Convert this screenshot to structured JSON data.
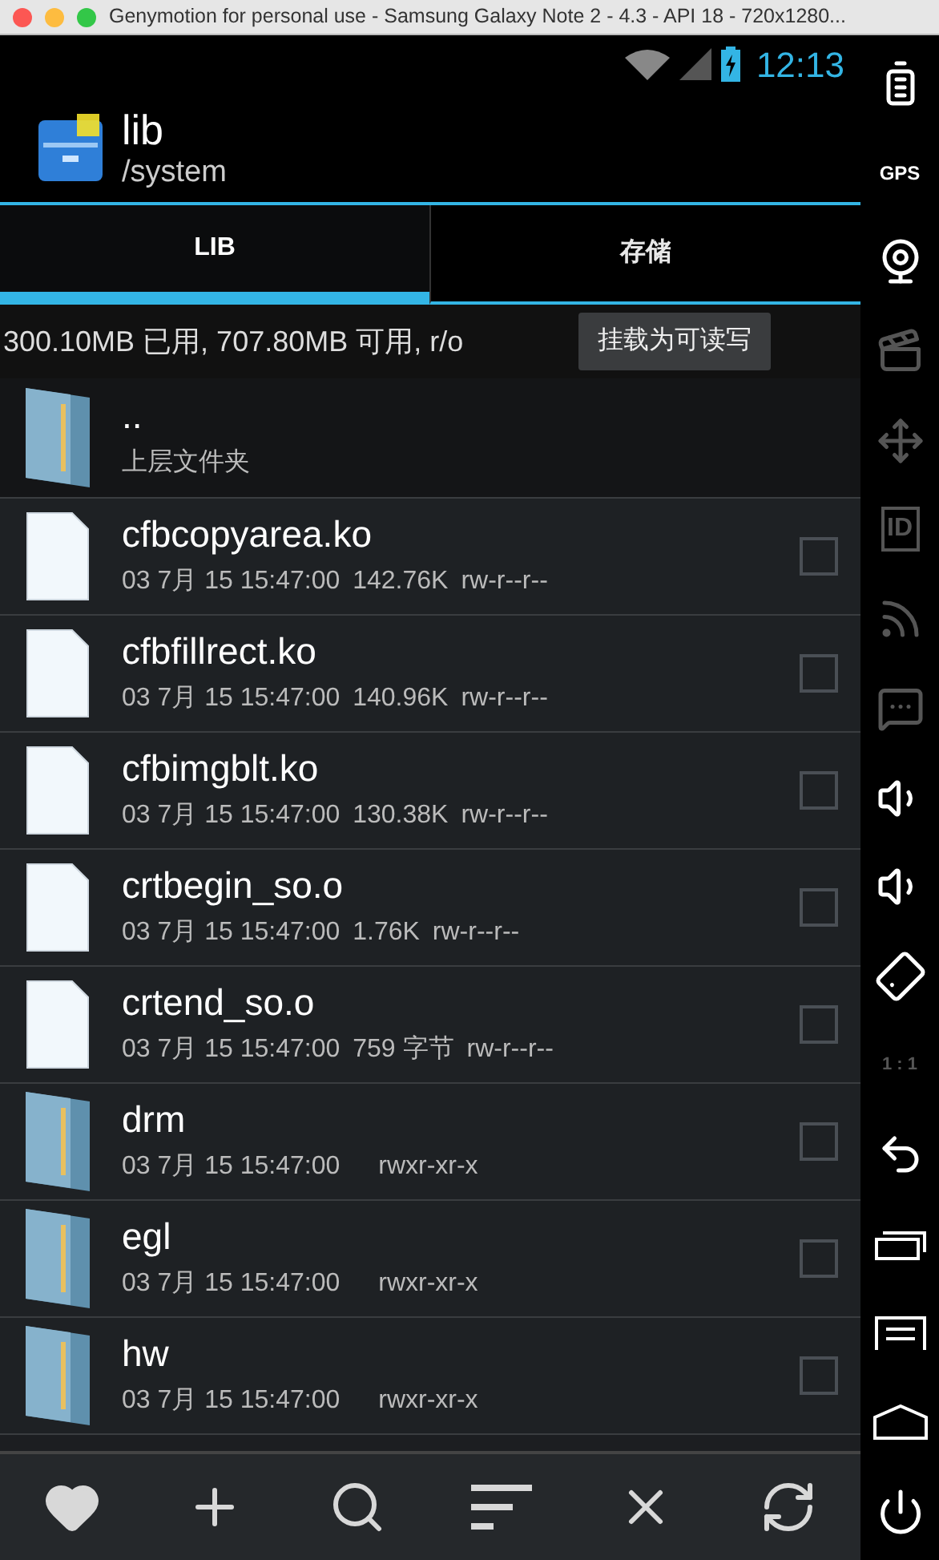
{
  "window": {
    "title": "Genymotion for personal use - Samsung Galaxy Note 2 - 4.3 - API 18 - 720x1280..."
  },
  "status_bar": {
    "time": "12:13"
  },
  "action_bar": {
    "title": "lib",
    "subtitle": "/system"
  },
  "tabs": [
    {
      "label": "LIB",
      "selected": true
    },
    {
      "label": "存储",
      "selected": false
    }
  ],
  "storage_info": {
    "text": "300.10MB 已用, 707.80MB 可用, r/o",
    "button": "挂载为可读写"
  },
  "files": [
    {
      "kind": "parent",
      "name": "..",
      "detail": "上层文件夹"
    },
    {
      "kind": "file",
      "name": "cfbcopyarea.ko",
      "date": "03 7月 15 15:47:00",
      "size": "142.76K",
      "permissions": "rw-r--r--",
      "checked": false
    },
    {
      "kind": "file",
      "name": "cfbfillrect.ko",
      "date": "03 7月 15 15:47:00",
      "size": "140.96K",
      "permissions": "rw-r--r--",
      "checked": false
    },
    {
      "kind": "file",
      "name": "cfbimgblt.ko",
      "date": "03 7月 15 15:47:00",
      "size": "130.38K",
      "permissions": "rw-r--r--",
      "checked": false
    },
    {
      "kind": "file",
      "name": "crtbegin_so.o",
      "date": "03 7月 15 15:47:00",
      "size": "1.76K",
      "permissions": "rw-r--r--",
      "checked": false
    },
    {
      "kind": "file",
      "name": "crtend_so.o",
      "date": "03 7月 15 15:47:00",
      "size": "759 字节",
      "permissions": "rw-r--r--",
      "checked": false
    },
    {
      "kind": "folder",
      "name": "drm",
      "date": "03 7月 15 15:47:00",
      "permissions": "rwxr-xr-x",
      "checked": false
    },
    {
      "kind": "folder",
      "name": "egl",
      "date": "03 7月 15 15:47:00",
      "permissions": "rwxr-xr-x",
      "checked": false
    },
    {
      "kind": "folder",
      "name": "hw",
      "date": "03 7月 15 15:47:00",
      "permissions": "rwxr-xr-x",
      "checked": false
    }
  ],
  "toolbar": [
    {
      "kind": "favorite"
    },
    {
      "kind": "add"
    },
    {
      "kind": "search"
    },
    {
      "kind": "sort"
    },
    {
      "kind": "close"
    },
    {
      "kind": "refresh"
    }
  ],
  "emulator_sidebar": [
    {
      "kind": "battery"
    },
    {
      "kind": "gps",
      "label": "GPS"
    },
    {
      "kind": "webcam"
    },
    {
      "kind": "clapper",
      "disabled": true
    },
    {
      "kind": "dpad",
      "disabled": true
    },
    {
      "kind": "id",
      "label": "ID",
      "disabled": true
    },
    {
      "kind": "cast",
      "disabled": true
    },
    {
      "kind": "sms",
      "disabled": true
    },
    {
      "kind": "volume_up"
    },
    {
      "kind": "volume_down"
    },
    {
      "kind": "rotate"
    },
    {
      "kind": "scale",
      "label": "1 : 1",
      "disabled": true
    },
    {
      "kind": "back"
    },
    {
      "kind": "recent"
    },
    {
      "kind": "menu"
    },
    {
      "kind": "home"
    },
    {
      "kind": "power"
    }
  ]
}
